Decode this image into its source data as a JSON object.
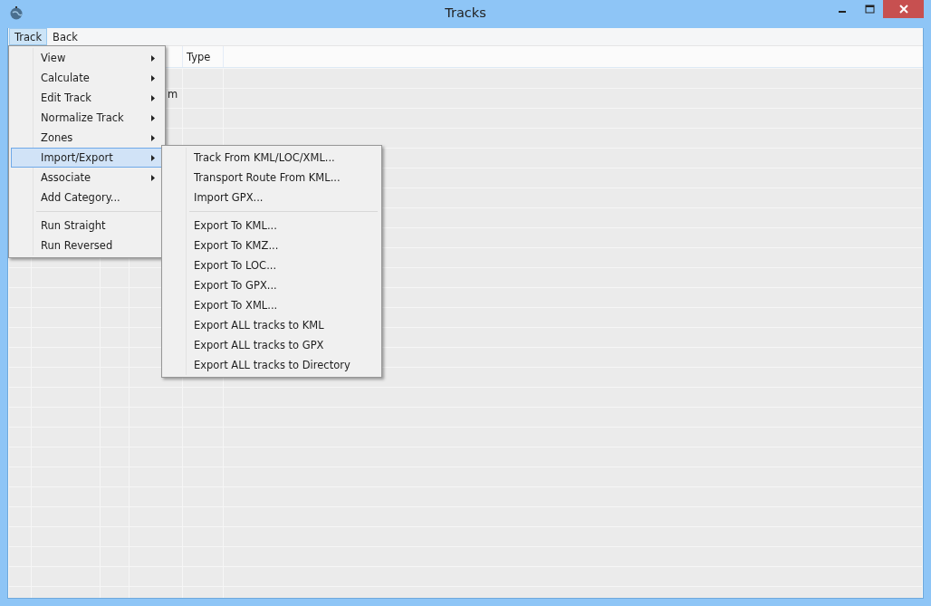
{
  "window": {
    "title": "Tracks"
  },
  "menu_bar": [
    {
      "label": "Track",
      "selected": true
    },
    {
      "label": "Back",
      "selected": false
    }
  ],
  "table": {
    "columns": [
      {
        "label": "Type"
      }
    ],
    "cells": [
      {
        "text": "m"
      }
    ]
  },
  "menu": [
    {
      "kind": "submenu",
      "label": "View",
      "selected": false
    },
    {
      "kind": "submenu",
      "label": "Calculate",
      "selected": false
    },
    {
      "kind": "submenu",
      "label": "Edit Track",
      "selected": false
    },
    {
      "kind": "submenu",
      "label": "Normalize Track",
      "selected": false
    },
    {
      "kind": "submenu",
      "label": "Zones",
      "selected": false
    },
    {
      "kind": "submenu",
      "label": "Import/Export",
      "selected": true
    },
    {
      "kind": "submenu",
      "label": "Associate",
      "selected": false
    },
    {
      "kind": "command",
      "label": "Add Category...",
      "selected": false
    },
    {
      "kind": "separator"
    },
    {
      "kind": "command",
      "label": "Run Straight",
      "selected": false
    },
    {
      "kind": "command",
      "label": "Run Reversed",
      "selected": false
    }
  ],
  "submenu": [
    {
      "kind": "command",
      "label": "Track From KML/LOC/XML...",
      "selected": false
    },
    {
      "kind": "command",
      "label": "Transport Route From KML...",
      "selected": false
    },
    {
      "kind": "command",
      "label": "Import GPX...",
      "selected": false
    },
    {
      "kind": "separator"
    },
    {
      "kind": "command",
      "label": "Export To KML...",
      "selected": false
    },
    {
      "kind": "command",
      "label": "Export To KMZ...",
      "selected": false
    },
    {
      "kind": "command",
      "label": "Export To LOC...",
      "selected": false
    },
    {
      "kind": "command",
      "label": "Export To GPX...",
      "selected": false
    },
    {
      "kind": "command",
      "label": "Export To XML...",
      "selected": false
    },
    {
      "kind": "command",
      "label": "Export ALL tracks to KML",
      "selected": false
    },
    {
      "kind": "command",
      "label": "Export ALL tracks to GPX",
      "selected": false
    },
    {
      "kind": "command",
      "label": "Export ALL tracks to Directory",
      "selected": false
    }
  ]
}
